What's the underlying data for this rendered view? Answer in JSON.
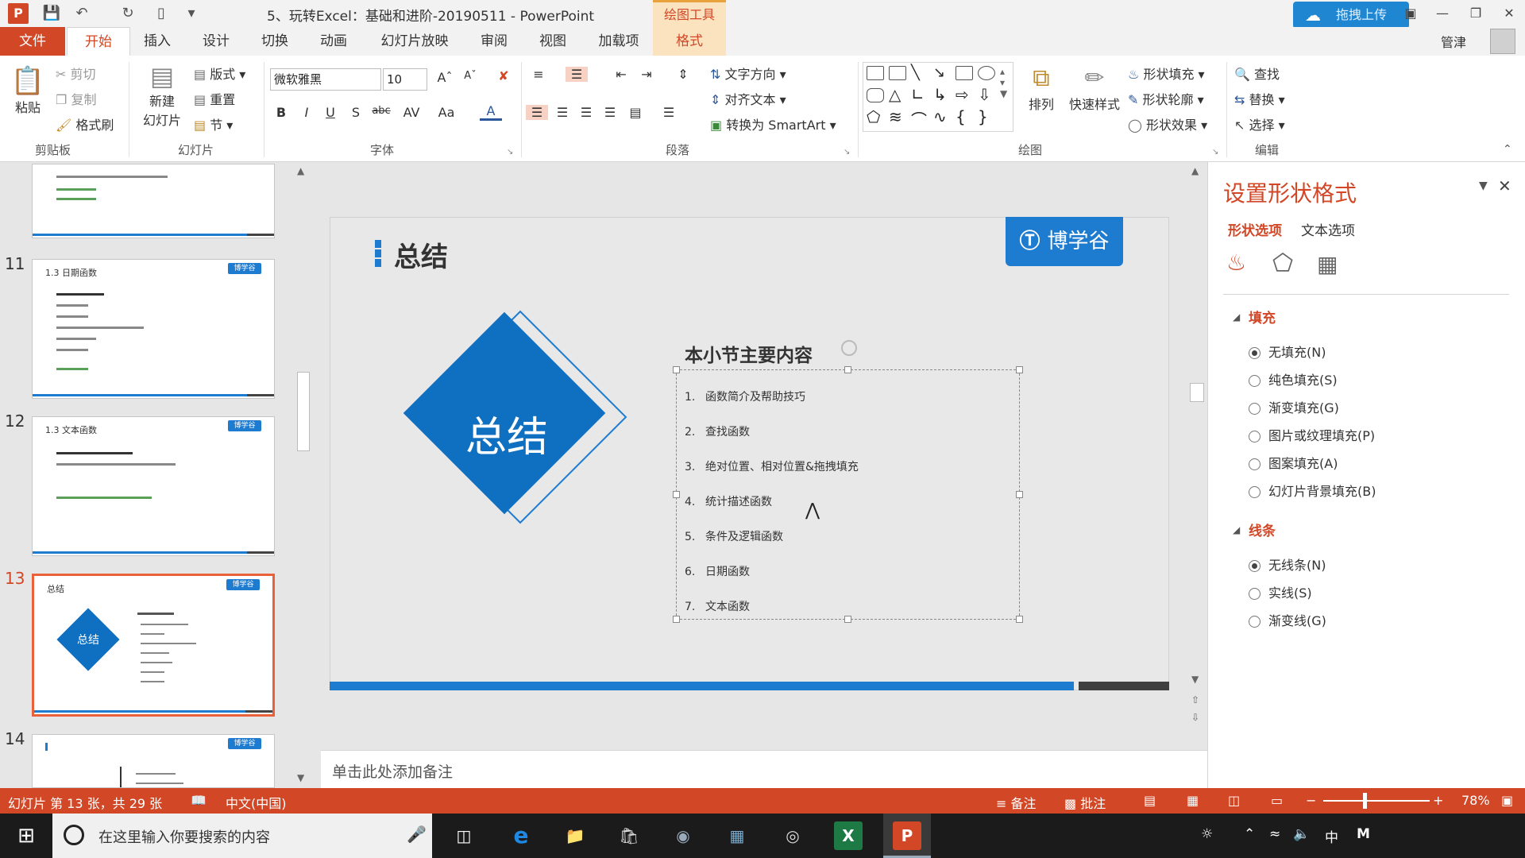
{
  "titlebar": {
    "doc_title": "5、玩转Excel：基础和进阶-20190511 - PowerPoint",
    "context_tool": "绘图工具",
    "upload_button": "拖拽上传",
    "user": "管津"
  },
  "tabs": [
    "文件",
    "开始",
    "插入",
    "设计",
    "切换",
    "动画",
    "幻灯片放映",
    "审阅",
    "视图",
    "加载项",
    "格式"
  ],
  "ribbon": {
    "clipboard": {
      "paste": "粘贴",
      "cut": "剪切",
      "copy": "复制",
      "format_painter": "格式刷",
      "label": "剪贴板"
    },
    "slides": {
      "new_slide_1": "新建",
      "new_slide_2": "幻灯片",
      "layout": "版式",
      "reset": "重置",
      "section": "节",
      "label": "幻灯片"
    },
    "font": {
      "name": "微软雅黑",
      "size": "10",
      "bold": "B",
      "italic": "I",
      "underline": "U",
      "shadow": "S",
      "strike": "abc",
      "spacing": "AV",
      "case": "Aa",
      "color": "A",
      "label": "字体"
    },
    "paragraph": {
      "text_direction": "文字方向",
      "align_text": "对齐文本",
      "smartart": "转换为 SmartArt",
      "label": "段落"
    },
    "drawing": {
      "arrange": "排列",
      "quick_styles": "快速样式",
      "shape_fill": "形状填充",
      "shape_outline": "形状轮廓",
      "shape_effects": "形状效果",
      "label": "绘图"
    },
    "editing": {
      "find": "查找",
      "replace": "替换",
      "select": "选择",
      "label": "编辑"
    }
  },
  "thumbnails": [
    {
      "num": "11",
      "title": "1.3 日期函数",
      "logo": "博学谷"
    },
    {
      "num": "12",
      "title": "1.3 文本函数",
      "logo": "博学谷"
    },
    {
      "num": "13",
      "title": "总结",
      "logo": "博学谷",
      "diamond": "总结",
      "selected": true
    },
    {
      "num": "14",
      "title": "",
      "logo": "博学谷"
    }
  ],
  "slide": {
    "title": "总结",
    "logo": "博学谷",
    "diamond_text": "总结",
    "content_heading": "本小节主要内容",
    "items": [
      {
        "n": "1.",
        "text": "函数简介及帮助技巧"
      },
      {
        "n": "2.",
        "text": "查找函数"
      },
      {
        "n": "3.",
        "text": "绝对位置、相对位置&拖拽填充"
      },
      {
        "n": "4.",
        "text": "统计描述函数"
      },
      {
        "n": "5.",
        "text": "条件及逻辑函数"
      },
      {
        "n": "6.",
        "text": "日期函数"
      },
      {
        "n": "7.",
        "text": "文本函数"
      }
    ]
  },
  "notes_placeholder": "单击此处添加备注",
  "format_pane": {
    "title": "设置形状格式",
    "tab_shape": "形状选项",
    "tab_text": "文本选项",
    "fill_heading": "填充",
    "fill_options": [
      "无填充(N)",
      "纯色填充(S)",
      "渐变填充(G)",
      "图片或纹理填充(P)",
      "图案填充(A)",
      "幻灯片背景填充(B)"
    ],
    "line_heading": "线条",
    "line_options": [
      "无线条(N)",
      "实线(S)",
      "渐变线(G)"
    ]
  },
  "statusbar": {
    "slide_info": "幻灯片 第 13 张，共 29 张",
    "language": "中文(中国)",
    "notes": "备注",
    "comments": "批注",
    "zoom": "78%"
  },
  "taskbar": {
    "search_placeholder": "在这里输入你要搜索的内容",
    "ime": "中",
    "ime2": "M"
  },
  "colors": {
    "accent": "#d24726",
    "brand_blue": "#1e7cd0",
    "slide_bg": "#e8e8e8"
  }
}
